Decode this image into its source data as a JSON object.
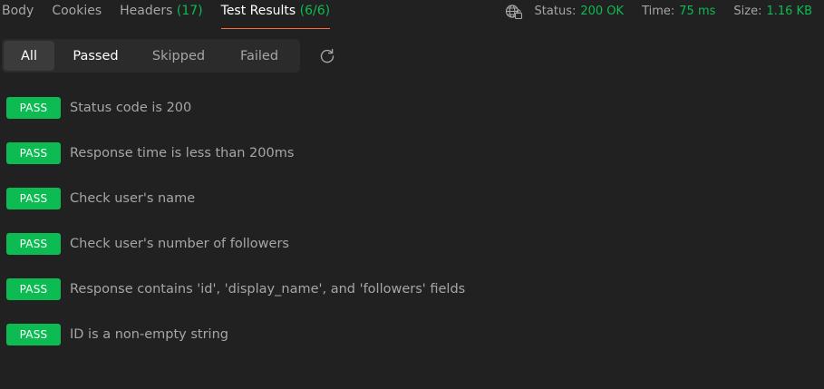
{
  "tabs": [
    {
      "label": "Body",
      "count": "",
      "active": false
    },
    {
      "label": "Cookies",
      "count": "",
      "active": false
    },
    {
      "label": "Headers",
      "count": "(17)",
      "active": false
    },
    {
      "label": "Test Results",
      "count": "(6/6)",
      "active": true
    }
  ],
  "response_meta": {
    "status_label": "Status:",
    "status_value": "200 OK",
    "time_label": "Time:",
    "time_value": "75 ms",
    "size_label": "Size:",
    "size_value": "1.16 KB",
    "network_icon": "globe-lock-icon"
  },
  "filters": {
    "all": "All",
    "passed": "Passed",
    "skipped": "Skipped",
    "failed": "Failed",
    "selected": "All",
    "refresh_icon": "refresh-icon"
  },
  "results": [
    {
      "status": "PASS",
      "name": "Status code is 200"
    },
    {
      "status": "PASS",
      "name": "Response time is less than 200ms"
    },
    {
      "status": "PASS",
      "name": "Check user's name"
    },
    {
      "status": "PASS",
      "name": "Check user's number of followers"
    },
    {
      "status": "PASS",
      "name": "Response contains 'id', 'display_name', and 'followers' fields"
    },
    {
      "status": "PASS",
      "name": "ID is a non-empty string"
    }
  ],
  "colors": {
    "background": "#212121",
    "pass": "#0cbb52",
    "active_tab_underline": "#ff6c37",
    "text_muted": "#a6a6a6",
    "text_active": "#ffffff"
  }
}
